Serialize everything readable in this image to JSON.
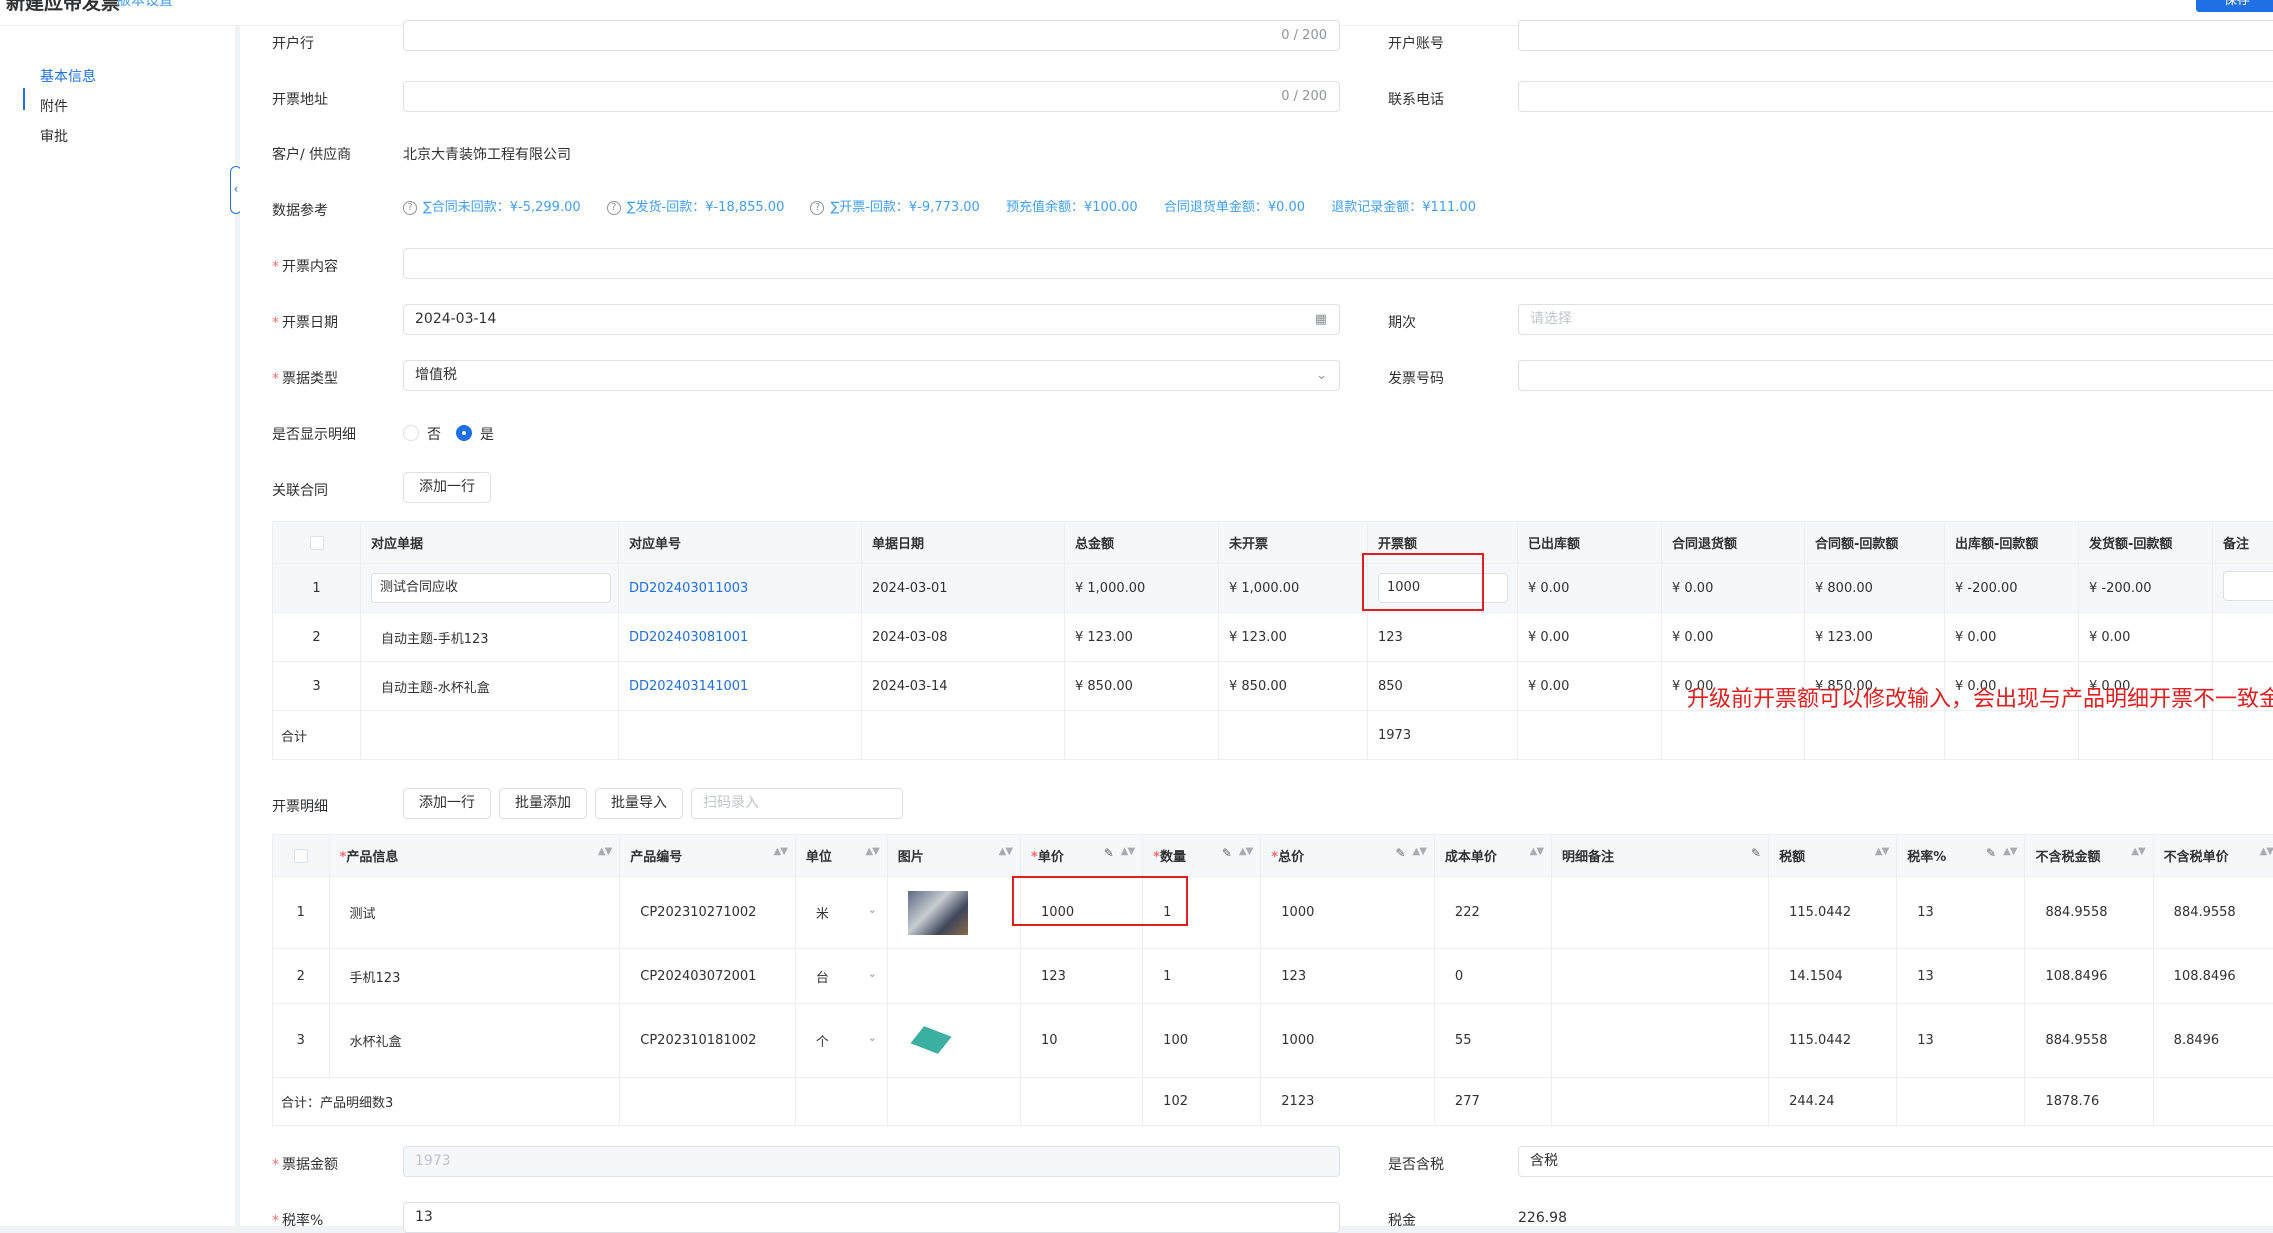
{
  "header": {
    "title": "新建应带发票",
    "subtitle": "版本设置",
    "action_label": "保存"
  },
  "sidebar": {
    "items": [
      {
        "label": "基本信息"
      },
      {
        "label": "附件"
      },
      {
        "label": "审批"
      }
    ]
  },
  "form": {
    "bank_label": "开户行",
    "bank_count": "0 / 200",
    "bank_account_label": "开户账号",
    "address_label": "开票地址",
    "address_count": "0 / 200",
    "phone_label": "联系电话",
    "customer_label": "客户/ 供应商",
    "customer_value": "北京大青装饰工程有限公司",
    "ref_label": "数据参考",
    "refs": [
      "∑合同未回款：¥-5,299.00",
      "∑发货-回款：¥-18,855.00",
      "∑开票-回款：¥-9,773.00",
      "预充值余额：¥100.00",
      "合同退货单金额：¥0.00",
      "退款记录金额：¥111.00"
    ],
    "content_label": "开票内容",
    "date_label": "开票日期",
    "date_value": "2024-03-14",
    "period_label": "期次",
    "period_placeholder": "请选择",
    "type_label": "票据类型",
    "type_value": "增值税",
    "invoice_no_label": "发票号码",
    "show_detail_label": "是否显示明细",
    "no_label": "否",
    "yes_label": "是",
    "contract_label": "关联合同",
    "add_row": "添加一行",
    "detail_label": "开票明细",
    "batch_add": "批量添加",
    "batch_import": "批量导入",
    "scan_placeholder": "扫码录入",
    "amount_label": "票据金额",
    "amount_value": "1973",
    "tax_included_label": "是否含税",
    "tax_included_value": "含税",
    "tax_rate_label": "税率%",
    "tax_rate_value": "13",
    "tax_label": "税金",
    "tax_value": "226.98"
  },
  "contract_table": {
    "headers": [
      "对应单据",
      "对应单号",
      "单据日期",
      "总金额",
      "未开票",
      "开票额",
      "已出库额",
      "合同退货额",
      "合同额-回款额",
      "出库额-回款额",
      "发货额-回款额",
      "备注"
    ],
    "rows": [
      {
        "idx": "1",
        "doc": "测试合同应收",
        "no": "DD202403011003",
        "date": "2024-03-01",
        "total": "¥ 1,000.00",
        "unbilled": "¥ 1,000.00",
        "billed": "1000",
        "out": "¥ 0.00",
        "ret": "¥ 0.00",
        "c_r": "¥ 800.00",
        "o_r": "¥ -200.00",
        "s_r": "¥ -200.00"
      },
      {
        "idx": "2",
        "doc": "自动主题-手机123",
        "no": "DD202403081001",
        "date": "2024-03-08",
        "total": "¥ 123.00",
        "unbilled": "¥ 123.00",
        "billed": "123",
        "out": "¥ 0.00",
        "ret": "¥ 0.00",
        "c_r": "¥ 123.00",
        "o_r": "¥ 0.00",
        "s_r": "¥ 0.00"
      },
      {
        "idx": "3",
        "doc": "自动主题-水杯礼盒",
        "no": "DD202403141001",
        "date": "2024-03-14",
        "total": "¥ 850.00",
        "unbilled": "¥ 850.00",
        "billed": "850",
        "out": "¥ 0.00",
        "ret": "¥ 0.00",
        "c_r": "¥ 850.00",
        "o_r": "¥ 0.00",
        "s_r": "¥ 0.00"
      }
    ],
    "total_label": "合计",
    "total_billed": "1973"
  },
  "detail_table": {
    "headers": [
      "产品信息",
      "产品编号",
      "单位",
      "图片",
      "单价",
      "数量",
      "总价",
      "成本单价",
      "明细备注",
      "税额",
      "税率%",
      "不含税金额",
      "不含税单价"
    ],
    "rows": [
      {
        "idx": "1",
        "name": "测试",
        "code": "CP202310271002",
        "unit": "米",
        "price": "1000",
        "qty": "1",
        "total": "1000",
        "cost": "222",
        "tax": "115.0442",
        "rate": "13",
        "net": "884.9558",
        "net_unit": "884.9558"
      },
      {
        "idx": "2",
        "name": "手机123",
        "code": "CP202403072001",
        "unit": "台",
        "price": "123",
        "qty": "1",
        "total": "123",
        "cost": "0",
        "tax": "14.1504",
        "rate": "13",
        "net": "108.8496",
        "net_unit": "108.8496"
      },
      {
        "idx": "3",
        "name": "水杯礼盒",
        "code": "CP202310181002",
        "unit": "个",
        "price": "10",
        "qty": "100",
        "total": "1000",
        "cost": "55",
        "tax": "115.0442",
        "rate": "13",
        "net": "884.9558",
        "net_unit": "8.8496"
      }
    ],
    "total_label": "合计：产品明细数3",
    "sum_qty": "102",
    "sum_total": "2123",
    "sum_cost": "277",
    "sum_tax": "244.24",
    "sum_net": "1878.76"
  },
  "annotation": "升级前开票额可以修改输入，会出现与产品明细开票不一致金额情况"
}
